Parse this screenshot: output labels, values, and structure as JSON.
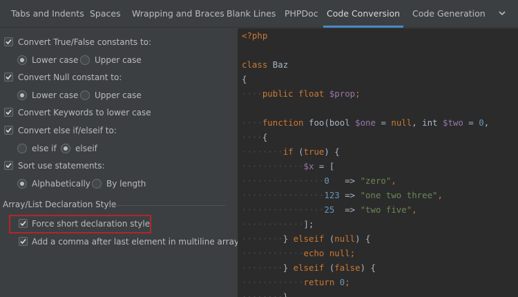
{
  "tabs": [
    "Tabs and Indents",
    "Spaces",
    "Wrapping and Braces",
    "Blank Lines",
    "PHPDoc",
    "Code Conversion",
    "Code Generation"
  ],
  "active_tab": "Code Conversion",
  "options": {
    "convert_true_false": "Convert True/False constants to:",
    "tf_lower": "Lower case",
    "tf_upper": "Upper case",
    "convert_null": "Convert Null constant to:",
    "null_lower": "Lower case",
    "null_upper": "Upper case",
    "convert_keywords": "Convert Keywords to lower case",
    "convert_else_if": "Convert else if/elseif to:",
    "else_if": "else if",
    "elseif": "elseif",
    "sort_use": "Sort use statements:",
    "alphabetically": "Alphabetically",
    "by_length": "By length"
  },
  "array_section": {
    "title": "Array/List Declaration Style",
    "force_short": "Force short declaration style",
    "add_comma": "Add a comma after last element in multiline array"
  },
  "code": {
    "l1": "<?php",
    "l3_kw": "class",
    "l3_name": " Baz",
    "l4": "{",
    "l5_kw": "public float",
    "l5_var": " $prop",
    "l5_end": ";",
    "l7_kw": "function",
    "l7_a": " foo(bool ",
    "l7_v1": "$one",
    "l7_b": " = ",
    "l7_null": "null",
    "l7_c": ", int ",
    "l7_v2": "$two",
    "l7_d": " = ",
    "l7_zero": "0",
    "l7_e": ",",
    "l8": "{",
    "l9_kw": "if",
    "l9_a": " (",
    "l9_true": "true",
    "l9_b": ") {",
    "l10_var": "$x",
    "l10_a": " = [",
    "l11_num": "0",
    "l11_a": "   => ",
    "l11_str": "\"zero\"",
    "l11_end": ",",
    "l12_num": "123",
    "l12_a": " => ",
    "l12_str": "\"one two three\"",
    "l12_end": ",",
    "l13_num": "25",
    "l13_a": "  => ",
    "l13_str": "\"two five\"",
    "l13_end": ",",
    "l14": "];",
    "l15_a": "} ",
    "l15_kw": "elseif",
    "l15_b": " (",
    "l15_null": "null",
    "l15_c": ") {",
    "l16_kw": "echo",
    "l16_null": " null",
    "l16_end": ";",
    "l17_a": "} ",
    "l17_kw": "elseif",
    "l17_b": " (",
    "l17_false": "false",
    "l17_c": ") {",
    "l18_kw": "return",
    "l18_num": " 0",
    "l18_end": ";",
    "l19": "}"
  }
}
